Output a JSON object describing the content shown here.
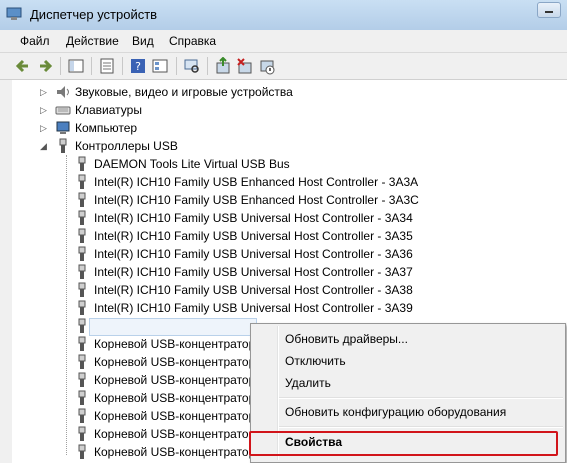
{
  "window": {
    "title": "Диспетчер устройств"
  },
  "menu": [
    "Файл",
    "Действие",
    "Вид",
    "Справка"
  ],
  "toolbar": [
    "back-icon",
    "forward-icon",
    "show-hide-tree-icon",
    "properties-icon",
    "help-icon",
    "view-icon",
    "scan-hardware-icon",
    "update-driver-icon",
    "uninstall-icon",
    "disable-icon"
  ],
  "tree": {
    "categories": [
      {
        "label": "Звуковые, видео и игровые устройства",
        "icon": "speaker-icon"
      },
      {
        "label": "Клавиатуры",
        "icon": "keyboard-icon"
      },
      {
        "label": "Компьютер",
        "icon": "computer-icon"
      },
      {
        "label": "Контроллеры USB",
        "icon": "usb-plug-icon"
      }
    ],
    "usb_devices": [
      "DAEMON Tools Lite Virtual USB Bus",
      "Intel(R) ICH10 Family USB Enhanced Host Controller - 3A3A",
      "Intel(R) ICH10 Family USB Enhanced Host Controller - 3A3C",
      "Intel(R) ICH10 Family USB Universal Host Controller - 3A34",
      "Intel(R) ICH10 Family USB Universal Host Controller - 3A35",
      "Intel(R) ICH10 Family USB Universal Host Controller - 3A36",
      "Intel(R) ICH10 Family USB Universal Host Controller - 3A37",
      "Intel(R) ICH10 Family USB Universal Host Controller - 3A38",
      "Intel(R) ICH10 Family USB Universal Host Controller - 3A39",
      "Корневой USB-концентратор",
      "Корневой USB-концентратор",
      "Корневой USB-концентратор",
      "Корневой USB-концентратор",
      "Корневой USB-концентратор",
      "Корневой USB-концентратор",
      "Корневой USB-концентратор",
      "Корневой USB-концентратор"
    ]
  },
  "context_menu": {
    "items": [
      "Обновить драйверы...",
      "Отключить",
      "Удалить",
      "Обновить конфигурацию оборудования",
      "Свойства"
    ]
  },
  "colors": {
    "highlight_box": "#d1141a",
    "selection": "#eef4fb"
  }
}
